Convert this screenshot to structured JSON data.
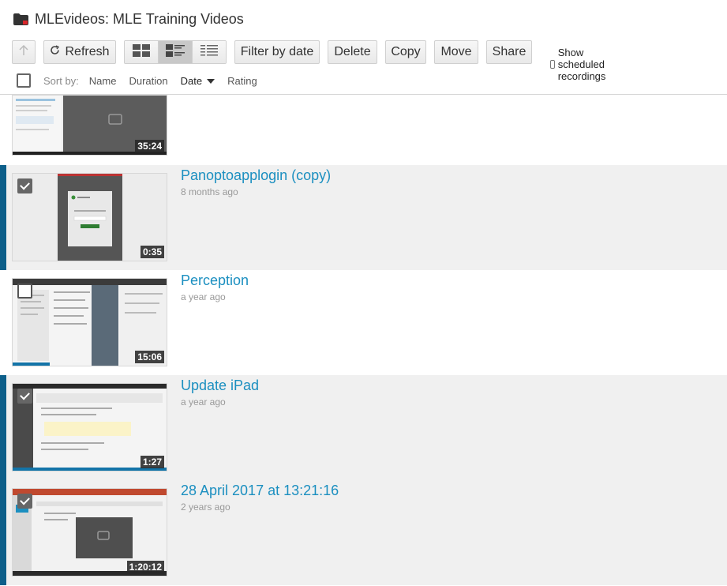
{
  "header": {
    "folder_title": "MLEvideos: MLE Training Videos"
  },
  "toolbar": {
    "refresh": "Refresh",
    "filter": "Filter by date",
    "delete": "Delete",
    "copy": "Copy",
    "move": "Move",
    "share": "Share",
    "show_scheduled": "Show scheduled recordings"
  },
  "sort": {
    "label": "Sort by:",
    "name": "Name",
    "duration": "Duration",
    "date": "Date",
    "rating": "Rating"
  },
  "sessions": [
    {
      "title": "",
      "age": "",
      "duration": "35:24",
      "checked": false,
      "selected": false
    },
    {
      "title": "Panoptoapplogin (copy)",
      "age": "8 months ago",
      "duration": "0:35",
      "checked": true,
      "selected": true
    },
    {
      "title": "Perception",
      "age": "a year ago",
      "duration": "15:06",
      "checked": false,
      "selected": false
    },
    {
      "title": "Update iPad",
      "age": "a year ago",
      "duration": "1:27",
      "checked": true,
      "selected": true
    },
    {
      "title": "28 April 2017 at 13:21:16",
      "age": "2 years ago",
      "duration": "1:20:12",
      "checked": true,
      "selected": true
    }
  ],
  "colors": {
    "accent": "#1b8fc0",
    "selected_bar": "#0d5f8a",
    "selected_bg": "#f0f0f0"
  }
}
